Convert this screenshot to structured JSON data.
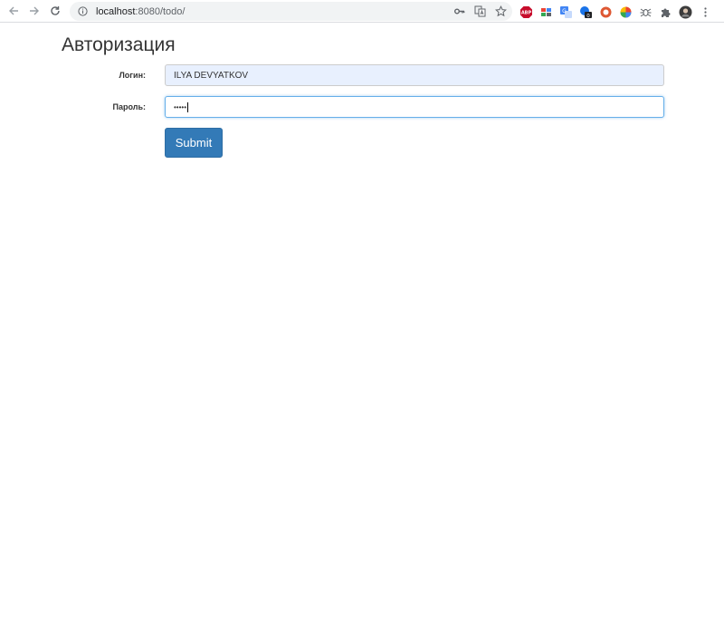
{
  "browser": {
    "url_host": "localhost",
    "url_rest": ":8080/todo/",
    "extensions": [
      {
        "name": "abp-extension-icon",
        "color": "#c70d2c"
      },
      {
        "name": "grid-extension-icon",
        "color": "#5f6368"
      },
      {
        "name": "translate-extension-icon",
        "color": "#4285f4"
      },
      {
        "name": "badge-extension-icon",
        "color": "#1a73e8"
      },
      {
        "name": "duckduckgo-extension-icon",
        "color": "#de5833"
      },
      {
        "name": "colorful-extension-icon",
        "color": "#34a853"
      },
      {
        "name": "bug-extension-icon",
        "color": "#5f6368"
      },
      {
        "name": "puzzle-extension-icon",
        "color": "#5f6368"
      },
      {
        "name": "profile-avatar-icon",
        "color": "#3c3c3c"
      }
    ]
  },
  "page": {
    "title": "Авторизация"
  },
  "form": {
    "login_label": "Логин:",
    "login_value": "ILYA DEVYATKOV",
    "password_label": "Пароль:",
    "password_mask": "•••••",
    "submit_label": "Submit"
  },
  "colors": {
    "accent": "#337ab7",
    "autofill_bg": "#e8f0fe",
    "focus_border": "#66afe9"
  }
}
